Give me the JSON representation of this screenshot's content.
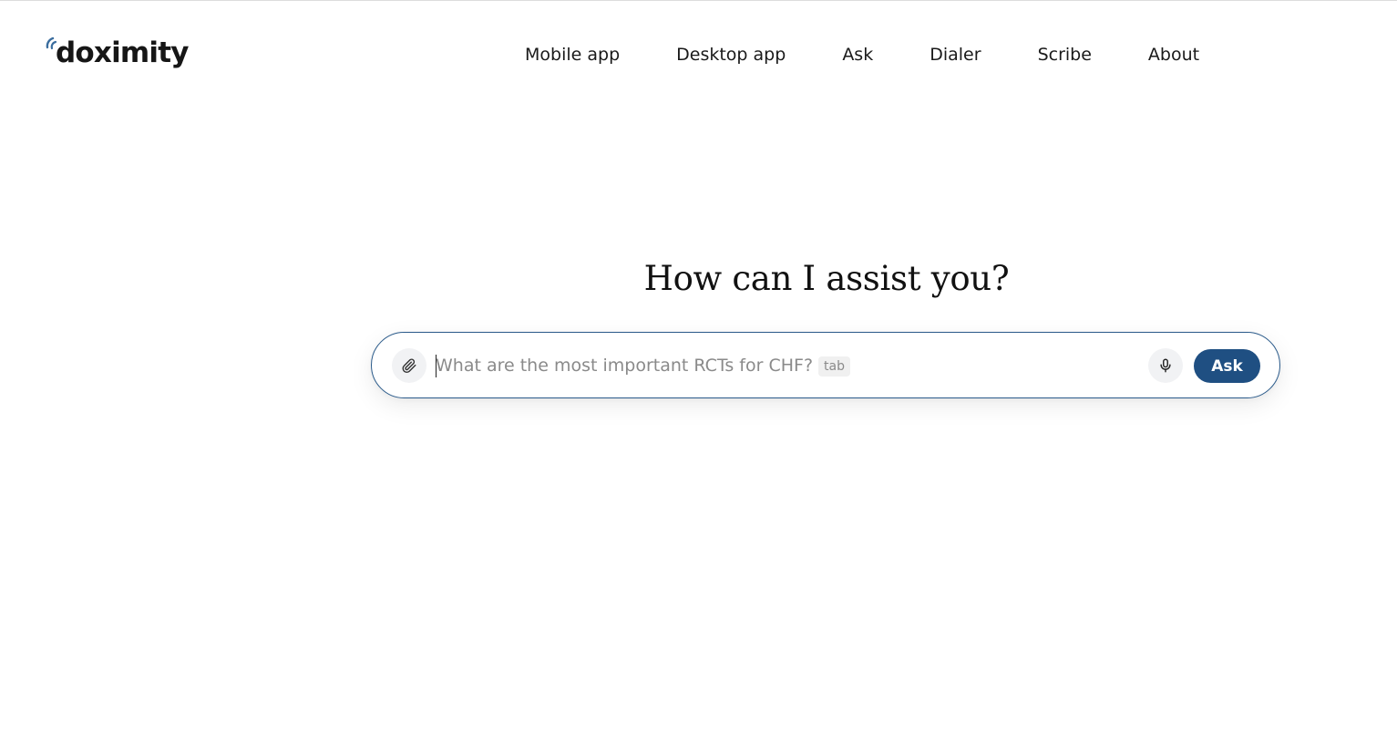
{
  "brand": {
    "name": "doximity",
    "logo_icon": "signal-arcs-icon",
    "accent_color": "#1f4f82"
  },
  "nav": {
    "items": [
      {
        "label": "Mobile app"
      },
      {
        "label": "Desktop app"
      },
      {
        "label": "Ask"
      },
      {
        "label": "Dialer"
      },
      {
        "label": "Scribe"
      },
      {
        "label": "About"
      }
    ]
  },
  "main": {
    "heading": "How can I assist you?",
    "search": {
      "value": "",
      "placeholder": "What are the most important RCTs for CHF?",
      "tab_hint": "tab",
      "attach_icon": "paperclip-icon",
      "mic_icon": "microphone-icon",
      "submit_label": "Ask"
    }
  }
}
